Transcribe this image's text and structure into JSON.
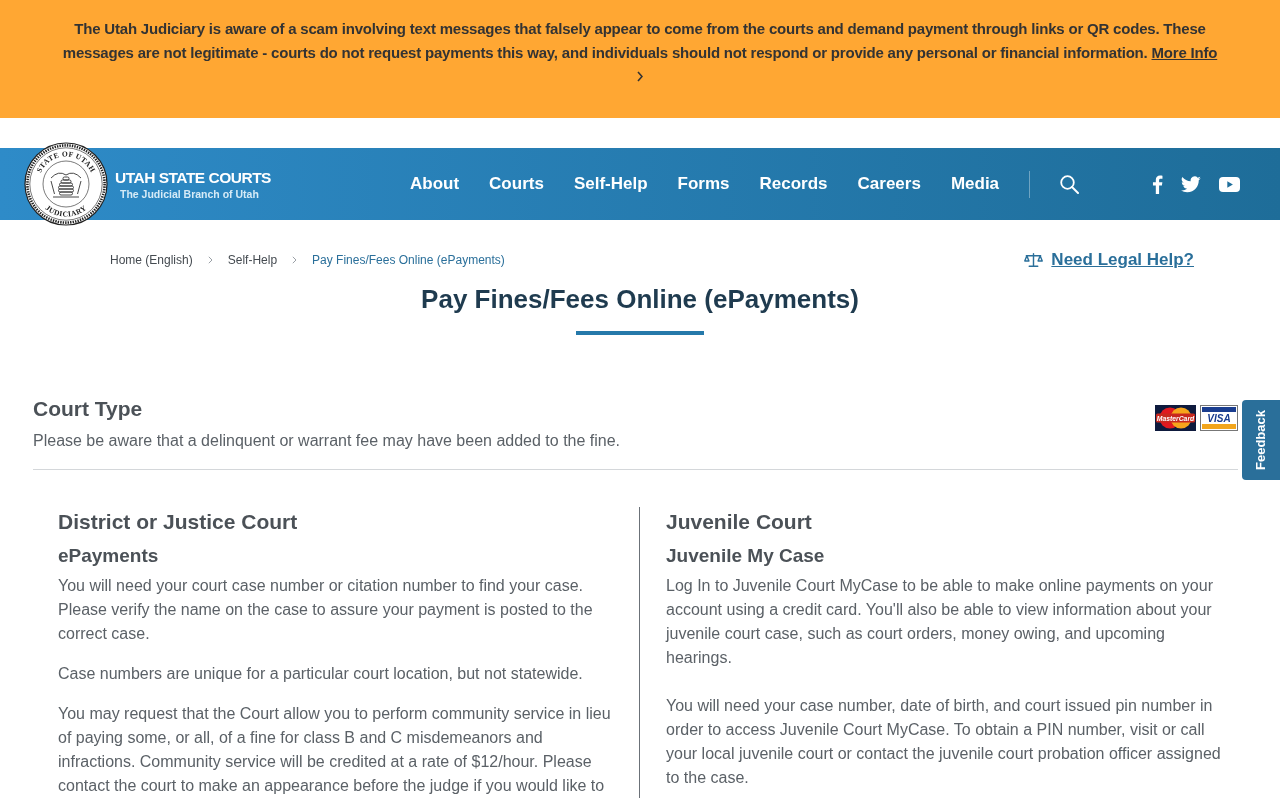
{
  "alert_banner": {
    "message": "The Utah Judiciary is aware of a scam involving text messages that falsely appear to come from the courts and demand payment through links or QR codes. These messages are not legitimate - courts do not request payments this way, and individuals should not respond or provide any personal or financial information.",
    "link": "More Info"
  },
  "header": {
    "logo": {
      "seal_top": "STATE OF UTAH",
      "seal_bottom": "JUDICIARY",
      "title": "UTAH STATE COURTS",
      "subtitle": "The Judicial Branch of Utah"
    },
    "nav": [
      "About",
      "Courts",
      "Self-Help",
      "Forms",
      "Records",
      "Careers",
      "Media"
    ],
    "social": [
      {
        "kind": "facebook"
      },
      {
        "kind": "twitter"
      },
      {
        "kind": "youtube"
      }
    ]
  },
  "breadcrumb": [
    {
      "label": "Home (English)",
      "current": false
    },
    {
      "label": "Self-Help",
      "current": false
    },
    {
      "label": "Pay Fines/Fees Online (ePayments)",
      "current": true
    }
  ],
  "legal_help_link": "Need Legal Help?",
  "page_title": "Pay Fines/Fees Online (ePayments)",
  "court_type": {
    "heading": "Court Type",
    "note": "Please be aware that a delinquent or warrant fee may have been added to the fine.",
    "payment_cards": [
      {
        "kind": "mastercard",
        "label": "MasterCard"
      },
      {
        "kind": "visa",
        "label": "VISA"
      }
    ]
  },
  "columns": [
    {
      "heading": "District or Justice Court",
      "subheading": "ePayments",
      "paragraphs": [
        "You will need your court case number or citation number to find your case. Please verify the name on the case to assure your payment is posted to the correct case.",
        "Case numbers are unique for a particular court location, but not statewide.",
        "You may request that the Court allow you to perform community service in lieu of paying some, or all, of a fine for class B and C misdemeanors and infractions. Community service will be credited at a rate of $12/hour. Please contact the court to make an appearance before the judge if you would like to"
      ]
    },
    {
      "heading": "Juvenile Court",
      "subheading": "Juvenile My Case",
      "paragraphs": [
        "Log In to Juvenile Court MyCase to be able to make online payments on your account using a credit card. You'll also be able to view information about your juvenile court case, such as court orders, money owing, and upcoming hearings.",
        "You will need your case number, date of birth, and court issued pin number in order to access Juvenile Court MyCase. To obtain a PIN number, visit or call your local juvenile court or contact the juvenile court probation officer assigned to the case."
      ]
    }
  ],
  "feedback_tab": "Feedback"
}
